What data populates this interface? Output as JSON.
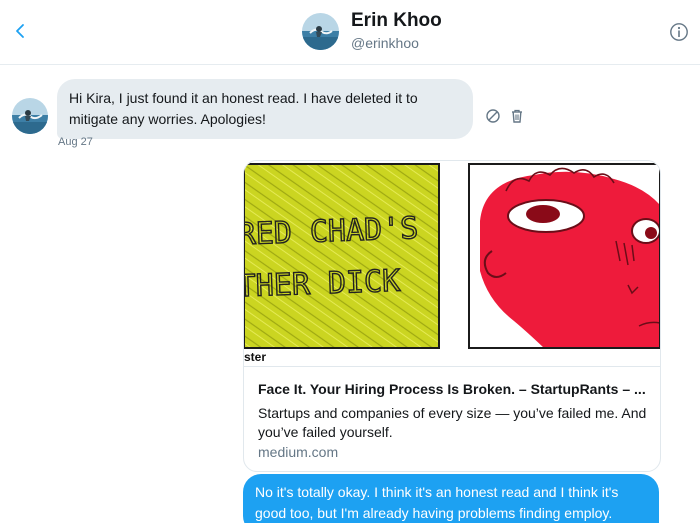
{
  "header": {
    "name": "Erin Khoo",
    "handle": "@erinkhoo"
  },
  "messages": {
    "incoming_text": "Hi Kira, I just found it an honest read. I have deleted it to mitigate any worries. Apologies!",
    "incoming_date": "Aug 27",
    "outgoing_text": "No it's totally okay. I think it's an honest read and I think it's good too, but I'm already having problems finding employ."
  },
  "card": {
    "image_left_text_line1": "RED CHAD'S",
    "image_left_text_line2": "THER DICK",
    "image_caption": "ster",
    "title": "Face It. Your Hiring Process Is Broken. – StartupRants – ...",
    "description": "Startups and companies of every size — you’ve failed me. And you’ve failed yourself.",
    "domain": "medium.com"
  },
  "colors": {
    "accent": "#1da1f2",
    "incoming_bubble": "#e6ecf0",
    "muted_text": "#657786",
    "left_panel_yellow": "#c9d41a",
    "right_panel_red": "#ef1d3c"
  },
  "icons": {
    "back": "chevron-left-icon",
    "info": "info-icon",
    "block": "block-icon",
    "delete": "trash-icon"
  }
}
